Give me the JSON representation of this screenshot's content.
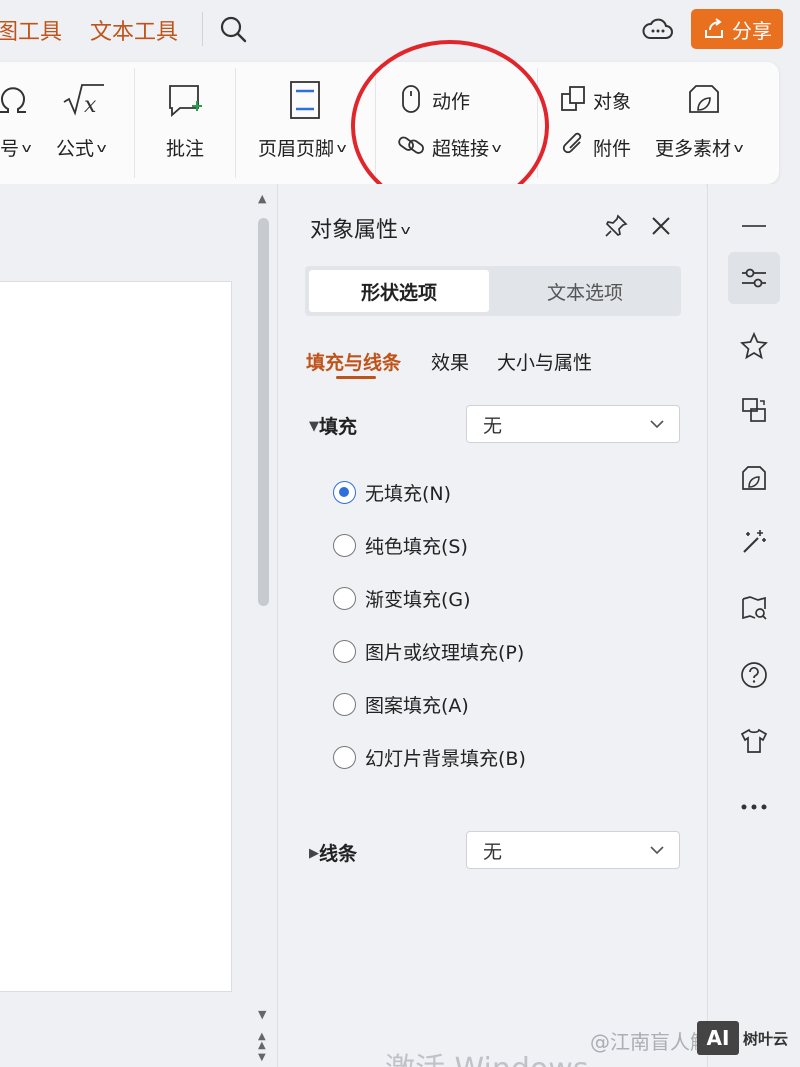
{
  "topbar": {
    "tabs": [
      "图工具",
      "文本工具"
    ],
    "share_label": "分享"
  },
  "ribbon": {
    "symbol_label": "号",
    "formula_label": "公式",
    "comment_label": "批注",
    "header_footer_label": "页眉页脚",
    "action_label": "动作",
    "hyperlink_label": "超链接",
    "object_label": "对象",
    "attachment_label": "附件",
    "more_material_label": "更多素材"
  },
  "panel": {
    "title": "对象属性",
    "segments": [
      "形状选项",
      "文本选项"
    ],
    "active_segment": "形状选项",
    "subtabs": [
      "填充与线条",
      "效果",
      "大小与属性"
    ],
    "active_subtab": "填充与线条",
    "fill": {
      "label": "填充",
      "value": "无",
      "options": [
        {
          "label": "无填充(N)",
          "checked": true
        },
        {
          "label": "纯色填充(S)",
          "checked": false
        },
        {
          "label": "渐变填充(G)",
          "checked": false
        },
        {
          "label": "图片或纹理填充(P)",
          "checked": false
        },
        {
          "label": "图案填充(A)",
          "checked": false
        },
        {
          "label": "幻灯片背景填充(B)",
          "checked": false
        }
      ]
    },
    "line": {
      "label": "线条",
      "value": "无"
    }
  },
  "sidebar": {
    "icons": [
      "minimize-icon",
      "property-sliders-icon",
      "star-icon",
      "switch-icon",
      "material-icon",
      "magic-wand-icon",
      "map-search-icon",
      "help-icon",
      "skin-icon",
      "more-icon"
    ]
  },
  "watermark": {
    "text": "@江南盲人解读",
    "badge": "AI",
    "badge_suffix": "树叶云",
    "activate": "激活 Windows"
  },
  "colors": {
    "accent_orange": "#c0531a",
    "share_bg": "#e8701f",
    "annotation_red": "#e0262b",
    "radio_blue": "#2f6fdc"
  }
}
